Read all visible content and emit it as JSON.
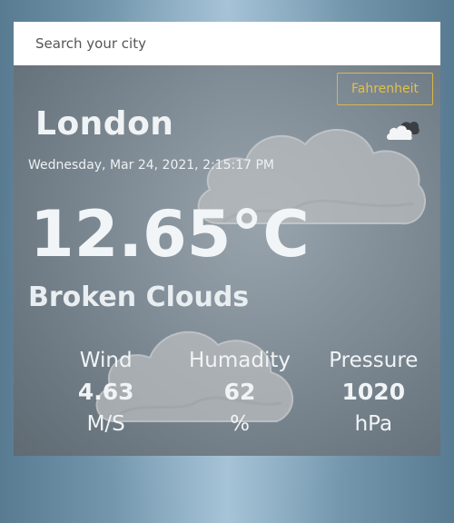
{
  "search": {
    "placeholder": "Search your city"
  },
  "unit_toggle": {
    "label": "Fahrenheit"
  },
  "weather": {
    "city": "London",
    "datetime": "Wednesday, Mar 24, 2021, 2:15:17 PM",
    "temperature": "12.65°C",
    "condition": "Broken Clouds",
    "icon": "broken-clouds-icon"
  },
  "stats": [
    {
      "label": "Wind",
      "value": "4.63",
      "unit": "M/S"
    },
    {
      "label": "Humadity",
      "value": "62",
      "unit": "%"
    },
    {
      "label": "Pressure",
      "value": "1020",
      "unit": "hPa"
    }
  ],
  "colors": {
    "accent": "#e1c04c",
    "text": "#f1f4f6",
    "card": "#7d878f"
  }
}
